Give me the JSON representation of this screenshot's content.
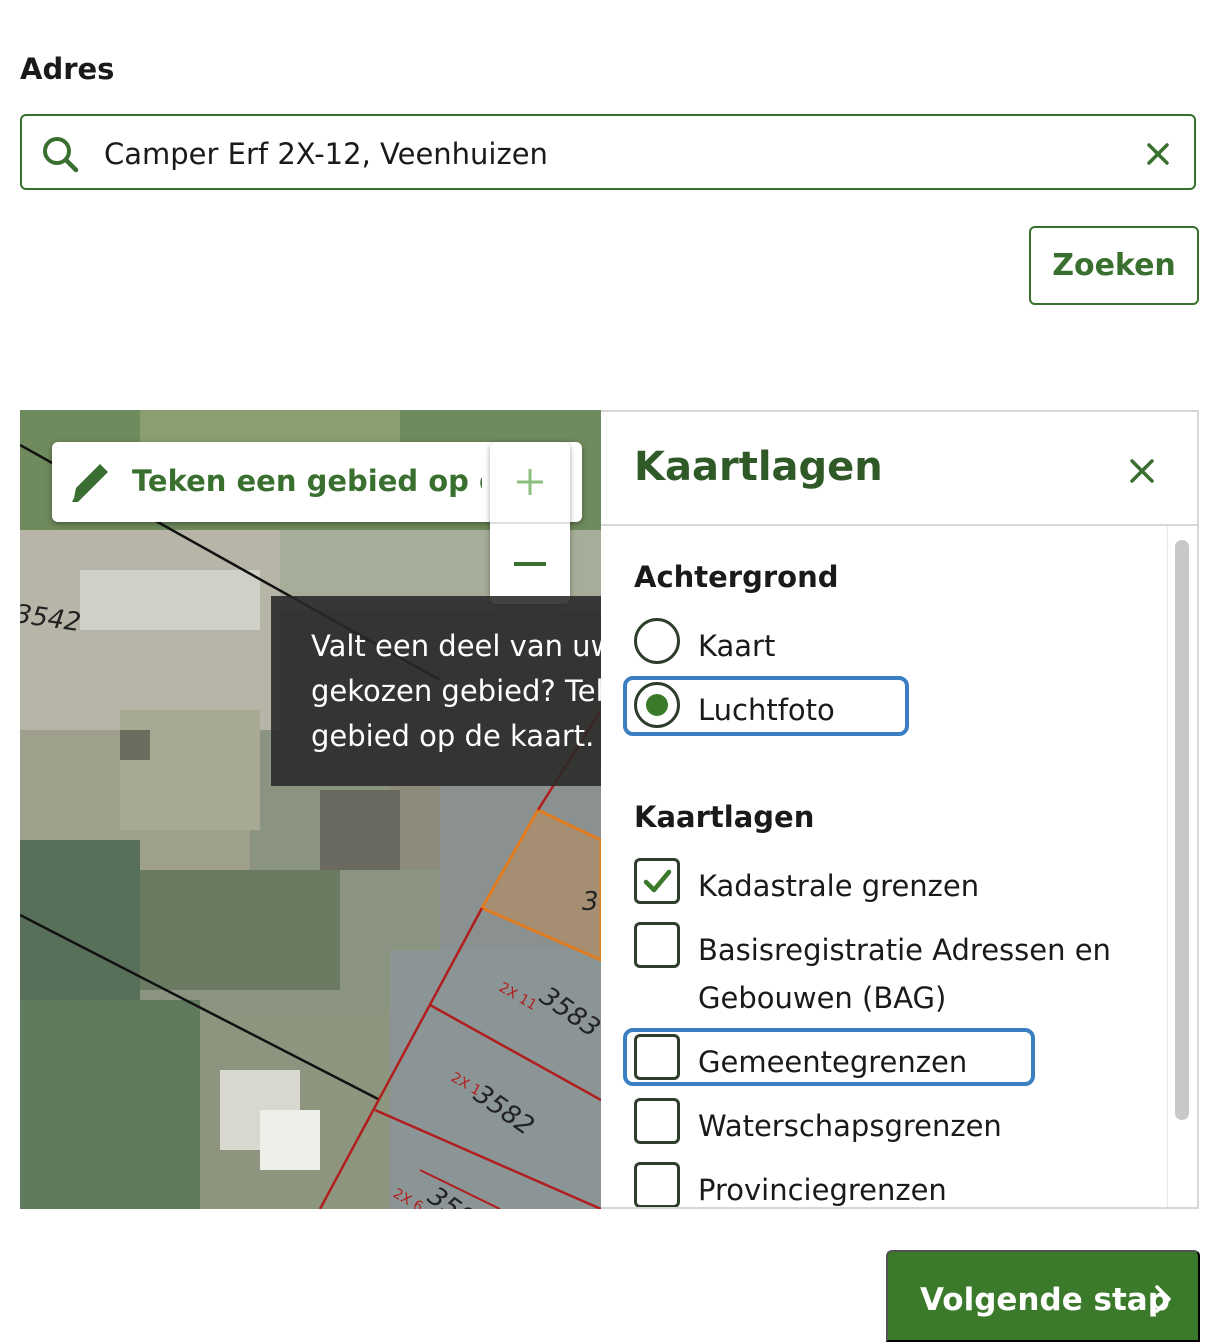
{
  "address": {
    "label": "Adres",
    "value": "Camper Erf 2X-12, Veenhuizen",
    "search_icon": "search-icon",
    "clear_icon": "close-icon"
  },
  "search_button": {
    "label": "Zoeken"
  },
  "map": {
    "draw_label": "Teken een gebied op de k",
    "draw_icon": "pencil-icon",
    "zoom_in_icon": "plus-icon",
    "zoom_out_icon": "minus-icon",
    "tooltip_lines": [
      "Valt een deel van uw",
      "gekozen gebied? Tek",
      "gebied op de kaart."
    ],
    "parcel_labels": [
      "3542",
      "2X 11",
      "3583",
      "2X 1",
      "3582",
      "2X 6",
      "358",
      "3"
    ]
  },
  "layers_panel": {
    "title": "Kaartlagen",
    "close_icon": "close-icon",
    "background_heading": "Achtergrond",
    "background_options": [
      {
        "label": "Kaart",
        "selected": false
      },
      {
        "label": "Luchtfoto",
        "selected": true
      }
    ],
    "layers_heading": "Kaartlagen",
    "layers": [
      {
        "label": "Kadastrale grenzen",
        "checked": true
      },
      {
        "label": "Basisregistratie Adressen en",
        "label_line2": "Gebouwen (BAG)",
        "checked": false
      },
      {
        "label": "Gemeentegrenzen",
        "checked": false
      },
      {
        "label": "Waterschapsgrenzen",
        "checked": false
      },
      {
        "label": "Provinciegrenzen",
        "checked": false
      }
    ]
  },
  "next_button": {
    "label": "Volgende stap",
    "icon": "chevron-right-icon"
  },
  "colors": {
    "brand_green": "#39702f",
    "button_green": "#3b7a2a",
    "title_green": "#2f5a27",
    "focus_blue": "#3a7fc1",
    "parcel_red": "#b01e1e",
    "parcel_orange": "#e07b1f"
  }
}
